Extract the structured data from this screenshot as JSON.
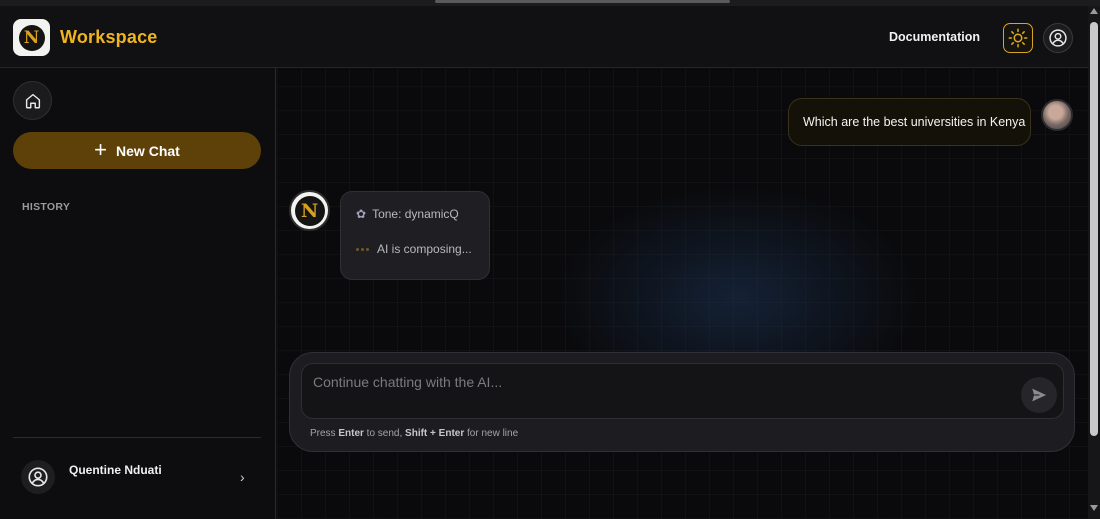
{
  "header": {
    "logo_letter": "N",
    "brand": "Workspace",
    "documentation_label": "Documentation",
    "theme_icon": "sun-icon",
    "account_icon": "user-circle-icon"
  },
  "sidebar": {
    "home_icon": "home-icon",
    "new_chat_label": "New Chat",
    "history_label": "HISTORY",
    "user": {
      "name": "Quentine Nduati",
      "chevron": "›"
    }
  },
  "chat": {
    "user_message": "Which are the best universities in Kenya",
    "ai": {
      "logo_letter": "N",
      "tone_label": "Tone: dynamicQ",
      "status": "AI is composing..."
    }
  },
  "composer": {
    "placeholder": "Continue chatting with the AI...",
    "hint_press": "Press ",
    "hint_enter": "Enter",
    "hint_to_send": " to send, ",
    "hint_shift_enter": "Shift + Enter",
    "hint_new_line": " for new line"
  },
  "colors": {
    "accent": "#f0b51e",
    "new_chat_bg": "#5e4108",
    "background": "#0c0c0e"
  }
}
